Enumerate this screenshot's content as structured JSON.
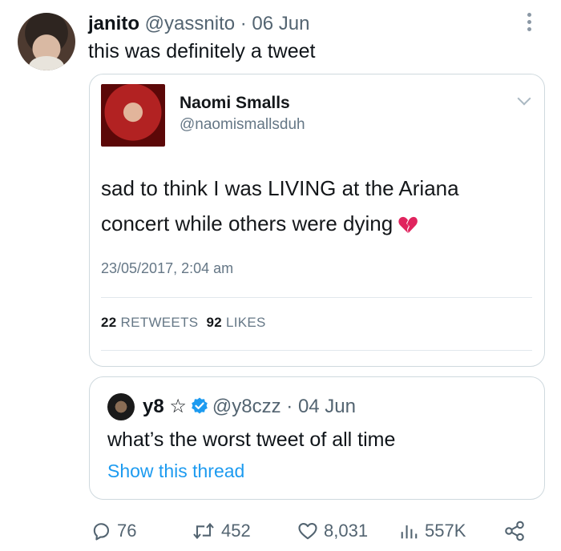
{
  "tweet": {
    "author_name": "janito",
    "author_handle": "@yassnito",
    "date_sep": " · ",
    "date": "06 Jun",
    "text": "this was definitely a tweet"
  },
  "embedded_tweet": {
    "name": "Naomi Smalls",
    "handle": "@naomismallsduh",
    "text": "sad to think I was LIVING at the Ariana concert while others were dying",
    "timestamp": "23/05/2017, 2:04 am",
    "retweets_count": "22",
    "retweets_label": "RETWEETS",
    "likes_count": "92",
    "likes_label": "LIKES",
    "emoji": "broken-heart-icon"
  },
  "quoted_tweet": {
    "name": "y8 ☆",
    "handle": "@y8czz",
    "date_sep": " · ",
    "date": "04 Jun",
    "text": "what’s the worst tweet of all time",
    "thread_link": "Show this thread"
  },
  "actions": {
    "replies": "76",
    "retweets": "452",
    "likes": "8,031",
    "views": "557K"
  },
  "colors": {
    "link": "#1d9bf0",
    "secondary_text": "#536471",
    "verified": "#1d9bf0",
    "heart": "#e0245e"
  }
}
